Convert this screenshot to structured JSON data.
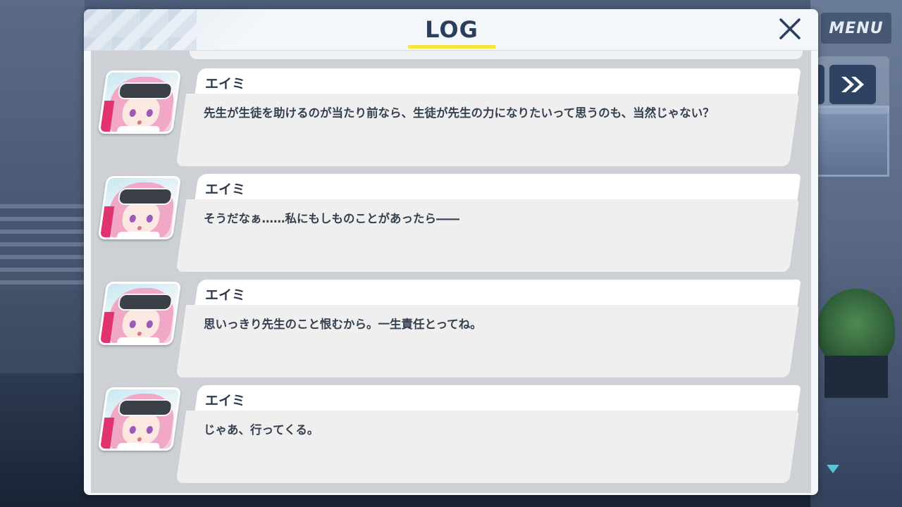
{
  "header": {
    "title": "LOG",
    "close_icon": "close-icon",
    "accent_color": "#f6e53c",
    "title_color": "#2a3f5e"
  },
  "overlay": {
    "menu_label": "MENU",
    "skip_icon": "fast-forward-icon",
    "scroll_indicator_icon": "triangle-down-icon"
  },
  "log": {
    "entries": [
      {
        "speaker": "エイミ",
        "text": "先生が生徒を助けるのが当たり前なら、生徒が先生の力になりたいって思うのも、当然じゃない？",
        "avatar": "eimi-avatar"
      },
      {
        "speaker": "エイミ",
        "text": "そうだなぁ……私にもしものことがあったら――",
        "avatar": "eimi-avatar"
      },
      {
        "speaker": "エイミ",
        "text": "思いっきり先生のこと恨むから。一生責任とってね。",
        "avatar": "eimi-avatar"
      },
      {
        "speaker": "エイミ",
        "text": "じゃあ、行ってくる。",
        "avatar": "eimi-avatar"
      }
    ]
  }
}
